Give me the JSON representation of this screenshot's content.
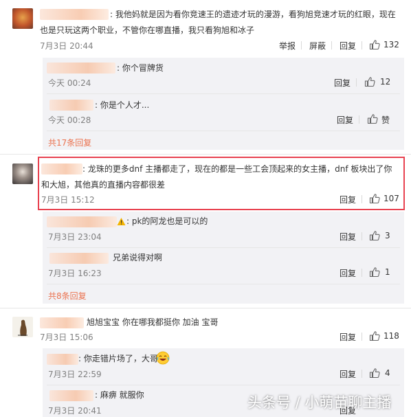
{
  "comments": [
    {
      "text": ": 我他妈就是因为看你竞速王的遗迹才玩的漫游，看狗旭竞速才玩的红眼，现在",
      "text2": "也是只玩这两个职业，不管你在哪直播，我只看狗旭和冰子",
      "time": "7月3日 20:44",
      "actions": [
        "举报",
        "屏蔽",
        "回复"
      ],
      "likes": "132",
      "replies": [
        {
          "text": ": 你个冒牌货",
          "time": "今天 00:24",
          "action": "回复",
          "likes": "12"
        },
        {
          "text": ": 你是个人才...",
          "time": "今天 00:28",
          "action": "回复",
          "likes": "赞"
        }
      ],
      "more": "共17条回复"
    },
    {
      "text": ": 龙珠的更多dnf 主播都走了，现在的都是一些工会顶起来的女主播，dnf 板块出了你",
      "text2": "和大旭，其他真的直播内容都很差",
      "time": "7月3日 15:12",
      "action": "回复",
      "likes": "107",
      "replies": [
        {
          "text": ": pk的阿龙也是可以的",
          "time": "7月3日 23:04",
          "action": "回复",
          "likes": "3"
        },
        {
          "text": "兄弟说得对啊",
          "time": "7月3日 16:23",
          "action": "回复",
          "likes": "1"
        }
      ],
      "more": "共8条回复"
    },
    {
      "text": "旭旭宝宝 你在哪我都挺你  加油 宝哥",
      "time": "7月3日 15:06",
      "action": "回复",
      "likes": "118",
      "replies": [
        {
          "text": ": 你走错片场了，大哥",
          "time": "7月3日 22:59",
          "action": "回复",
          "likes": "4"
        },
        {
          "text": ": 麻痹 就服你",
          "time": "7月3日 20:41",
          "action": "回复",
          "likes": ""
        }
      ]
    }
  ],
  "watermark": "头条号 / 小萌苗聊主播",
  "colors": {
    "accent": "#eb7350",
    "highlight_border": "#e8414f",
    "reply_bg": "#f2f2f5"
  },
  "icons": [
    "thumb-up-icon",
    "laughing-emoji-icon",
    "warning-emoji-icon"
  ]
}
